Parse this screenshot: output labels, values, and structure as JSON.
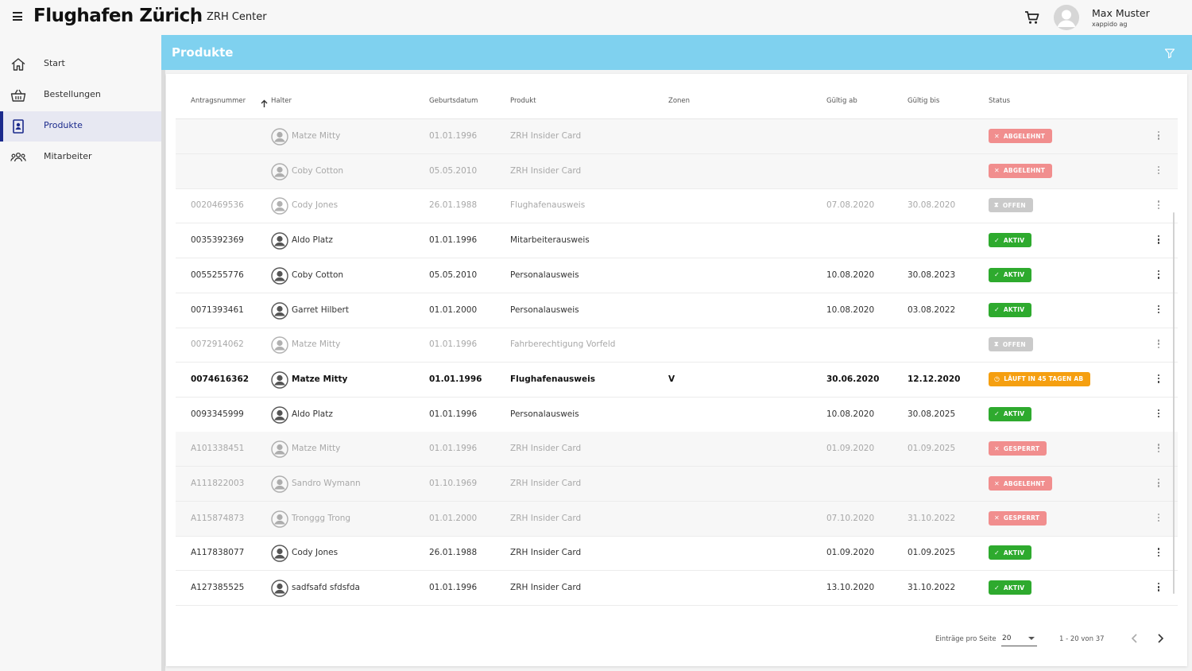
{
  "header": {
    "brand": "Flughafen Zürich",
    "subtitle": "ZRH Center",
    "user_name": "Max Muster",
    "user_company": "xappido ag"
  },
  "sidebar": {
    "items": [
      {
        "label": "Start",
        "icon": "home-icon",
        "active": false
      },
      {
        "label": "Bestellungen",
        "icon": "basket-icon",
        "active": false
      },
      {
        "label": "Produkte",
        "icon": "id-card-icon",
        "active": true
      },
      {
        "label": "Mitarbeiter",
        "icon": "people-icon",
        "active": false
      }
    ]
  },
  "page": {
    "title": "Produkte"
  },
  "table": {
    "columns": [
      "Antragsnummer",
      "Halter",
      "Geburtsdatum",
      "Produkt",
      "Zonen",
      "Gültig ab",
      "Gültig bis",
      "Status"
    ],
    "sort_column": "Antragsnummer",
    "sort_direction": "ascending",
    "rows": [
      {
        "antrag": "",
        "halter": "Matze Mitty",
        "geburt": "01.01.1996",
        "produkt": "ZRH Insider Card",
        "zonen": "",
        "ab": "",
        "bis": "",
        "status": "ABGELEHNT",
        "status_type": "rejected",
        "style": "faded-shaded"
      },
      {
        "antrag": "",
        "halter": "Coby Cotton",
        "geburt": "05.05.2010",
        "produkt": "ZRH Insider Card",
        "zonen": "",
        "ab": "",
        "bis": "",
        "status": "ABGELEHNT",
        "status_type": "rejected",
        "style": "faded-shaded"
      },
      {
        "antrag": "0020469536",
        "halter": "Cody Jones",
        "geburt": "26.01.1988",
        "produkt": "Flughafenausweis",
        "zonen": "",
        "ab": "07.08.2020",
        "bis": "30.08.2020",
        "status": "OFFEN",
        "status_type": "open",
        "style": "faded"
      },
      {
        "antrag": "0035392369",
        "halter": "Aldo Platz",
        "geburt": "01.01.1996",
        "produkt": "Mitarbeiterausweis",
        "zonen": "",
        "ab": "",
        "bis": "",
        "status": "AKTIV",
        "status_type": "active",
        "style": "normal"
      },
      {
        "antrag": "0055255776",
        "halter": "Coby Cotton",
        "geburt": "05.05.2010",
        "produkt": "Personalausweis",
        "zonen": "",
        "ab": "10.08.2020",
        "bis": "30.08.2023",
        "status": "AKTIV",
        "status_type": "active",
        "style": "normal"
      },
      {
        "antrag": "0071393461",
        "halter": "Garret Hilbert",
        "geburt": "01.01.2000",
        "produkt": "Personalausweis",
        "zonen": "",
        "ab": "10.08.2020",
        "bis": "03.08.2022",
        "status": "AKTIV",
        "status_type": "active",
        "style": "normal"
      },
      {
        "antrag": "0072914062",
        "halter": "Matze Mitty",
        "geburt": "01.01.1996",
        "produkt": "Fahrberechtigung Vorfeld",
        "zonen": "",
        "ab": "",
        "bis": "",
        "status": "OFFEN",
        "status_type": "open",
        "style": "faded"
      },
      {
        "antrag": "0074616362",
        "halter": "Matze Mitty",
        "geburt": "01.01.1996",
        "produkt": "Flughafenausweis",
        "zonen": "V",
        "ab": "30.06.2020",
        "bis": "12.12.2020",
        "status": "LÄUFT IN 45 TAGEN AB",
        "status_type": "expiring",
        "style": "bold"
      },
      {
        "antrag": "0093345999",
        "halter": "Aldo Platz",
        "geburt": "01.01.1996",
        "produkt": "Personalausweis",
        "zonen": "",
        "ab": "10.08.2020",
        "bis": "30.08.2025",
        "status": "AKTIV",
        "status_type": "active",
        "style": "normal"
      },
      {
        "antrag": "A101338451",
        "halter": "Matze Mitty",
        "geburt": "01.01.1996",
        "produkt": "ZRH Insider Card",
        "zonen": "",
        "ab": "01.09.2020",
        "bis": "01.09.2025",
        "status": "GESPERRT",
        "status_type": "rejected",
        "style": "faded-shaded"
      },
      {
        "antrag": "A111822003",
        "halter": "Sandro Wymann",
        "geburt": "01.10.1969",
        "produkt": "ZRH Insider Card",
        "zonen": "",
        "ab": "",
        "bis": "",
        "status": "ABGELEHNT",
        "status_type": "rejected",
        "style": "faded-shaded"
      },
      {
        "antrag": "A115874873",
        "halter": "Tronggg Trong",
        "geburt": "01.01.2000",
        "produkt": "ZRH Insider Card",
        "zonen": "",
        "ab": "07.10.2020",
        "bis": "31.10.2022",
        "status": "GESPERRT",
        "status_type": "rejected",
        "style": "faded-shaded"
      },
      {
        "antrag": "A117838077",
        "halter": "Cody Jones",
        "geburt": "26.01.1988",
        "produkt": "ZRH Insider Card",
        "zonen": "",
        "ab": "01.09.2020",
        "bis": "01.09.2025",
        "status": "AKTIV",
        "status_type": "active",
        "style": "normal"
      },
      {
        "antrag": "A127385525",
        "halter": "sadfsafd sfdsfda",
        "geburt": "01.01.1996",
        "produkt": "ZRH Insider Card",
        "zonen": "",
        "ab": "13.10.2020",
        "bis": "31.10.2022",
        "status": "AKTIV",
        "status_type": "active",
        "style": "normal"
      }
    ]
  },
  "pagination": {
    "per_page_label": "Einträge pro Seite",
    "per_page_value": "20",
    "range_label": "1 - 20 von 37"
  },
  "colors": {
    "header_bg": "#7fd1ef",
    "nav_active": "#1b2a8c",
    "status_rejected": "#ef6b6b",
    "status_open": "#b9b9b9",
    "status_active": "#2eaa2e",
    "status_expiring": "#f59f10"
  }
}
